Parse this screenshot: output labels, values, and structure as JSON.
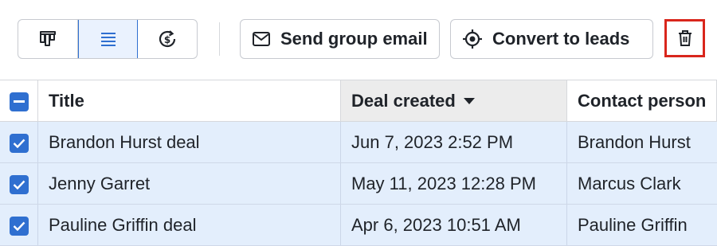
{
  "toolbar": {
    "views": [
      {
        "name": "pipeline-view",
        "icon": "pipeline-columns-icon",
        "active": false
      },
      {
        "name": "list-view",
        "icon": "list-lines-icon",
        "active": true
      },
      {
        "name": "forecast-view",
        "icon": "forecast-dollar-icon",
        "active": false
      }
    ],
    "send_email_label": "Send group email",
    "convert_label": "Convert to leads",
    "delete_icon": "trash-icon"
  },
  "table": {
    "columns": [
      {
        "label": "Title"
      },
      {
        "label": "Deal created",
        "sorted": "descending"
      },
      {
        "label": "Contact person"
      }
    ],
    "rows": [
      {
        "title": "Brandon Hurst deal",
        "created": "Jun 7, 2023 2:52 PM",
        "contact": "Brandon Hurst",
        "checked": true
      },
      {
        "title": "Jenny Garret",
        "created": "May 11, 2023 12:28 PM",
        "contact": "Marcus Clark",
        "checked": true
      },
      {
        "title": "Pauline Griffin deal",
        "created": "Apr 6, 2023 10:51 AM",
        "contact": "Pauline Griffin",
        "checked": true
      }
    ]
  },
  "colors": {
    "accent": "#2f6fd0",
    "selected_row": "#e3eefc",
    "highlight_border": "#d9261c"
  }
}
